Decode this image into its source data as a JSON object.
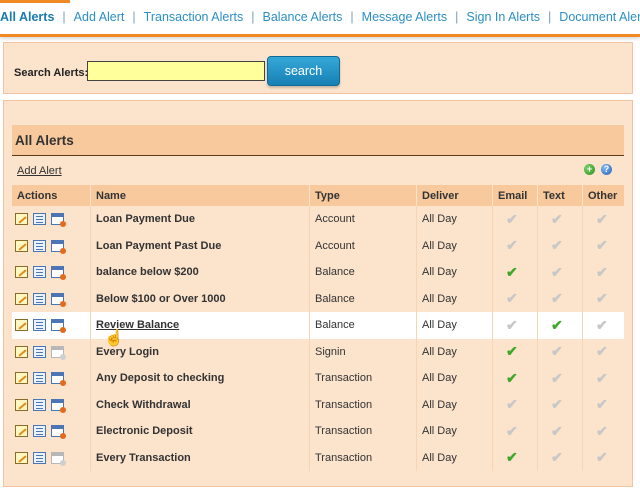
{
  "nav": {
    "items": [
      {
        "label": "All Alerts",
        "active": true
      },
      {
        "label": "Add Alert"
      },
      {
        "label": "Transaction Alerts"
      },
      {
        "label": "Balance Alerts"
      },
      {
        "label": "Message Alerts"
      },
      {
        "label": "Sign In Alerts"
      },
      {
        "label": "Document Alerts"
      }
    ],
    "separator": "|"
  },
  "search": {
    "label": "Search Alerts:",
    "value": "",
    "button_label": "search"
  },
  "alerts": {
    "title": "All Alerts",
    "add_link": "Add Alert",
    "icons": {
      "add": "plus-icon",
      "help": "help-icon"
    },
    "columns": [
      "Actions",
      "Name",
      "Type",
      "Deliver",
      "Email",
      "Text",
      "Other"
    ],
    "rows": [
      {
        "name": "Loan Payment Due",
        "type": "Account",
        "deliver": "All Day",
        "email": false,
        "text": false,
        "other": false,
        "active": true
      },
      {
        "name": "Loan Payment Past Due",
        "type": "Account",
        "deliver": "All Day",
        "email": false,
        "text": false,
        "other": false,
        "active": true
      },
      {
        "name": "balance below $200",
        "type": "Balance",
        "deliver": "All Day",
        "email": true,
        "text": false,
        "other": false,
        "active": true
      },
      {
        "name": "Below $100 or Over 1000",
        "type": "Balance",
        "deliver": "All Day",
        "email": false,
        "text": false,
        "other": false,
        "active": true
      },
      {
        "name": "Review Balance",
        "type": "Balance",
        "deliver": "All Day",
        "email": false,
        "text": true,
        "other": false,
        "active": true,
        "hover": true
      },
      {
        "name": "Every Login",
        "type": "Signin",
        "deliver": "All Day",
        "email": true,
        "text": false,
        "other": false,
        "active": false
      },
      {
        "name": "Any Deposit to checking",
        "type": "Transaction",
        "deliver": "All Day",
        "email": true,
        "text": false,
        "other": false,
        "active": true
      },
      {
        "name": "Check Withdrawal",
        "type": "Transaction",
        "deliver": "All Day",
        "email": false,
        "text": false,
        "other": false,
        "active": true
      },
      {
        "name": "Electronic Deposit",
        "type": "Transaction",
        "deliver": "All Day",
        "email": false,
        "text": false,
        "other": false,
        "active": true
      },
      {
        "name": "Every Transaction",
        "type": "Transaction",
        "deliver": "All Day",
        "email": true,
        "text": false,
        "other": false,
        "active": false
      }
    ]
  },
  "colors": {
    "accent": "#f08a24",
    "link": "#2c8fc4",
    "panel": "#fbe3cc",
    "header": "#f7c99c",
    "check_on": "#3da82a",
    "check_off": "#c7c7c7"
  }
}
